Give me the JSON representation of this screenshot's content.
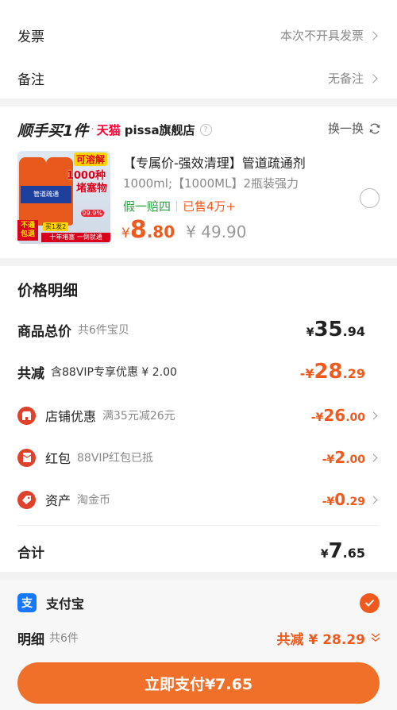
{
  "invoice": {
    "label": "发票",
    "value": "本次不开具发票"
  },
  "note": {
    "label": "备注",
    "value": "无备注"
  },
  "promo": {
    "brand_text": "顺手买1件",
    "dot": "·",
    "tmall": "天猫",
    "shop": "pissa旗舰店",
    "swap": "换一换"
  },
  "product": {
    "title": "【专属价-强效清理】管道疏通剂",
    "spec": "1000ml;【1000ML】2瓶装强力",
    "guarantee": "假一赔四",
    "sold": "已售4万+",
    "price_symbol": "¥",
    "price_int": "8",
    "price_dec": ".80",
    "original_price": "¥ 49.90",
    "thumb": {
      "tag1": "可溶解",
      "tag2": "1000种",
      "tag3": "堵塞物",
      "bottle_label": "管道疏通",
      "percent": "99.9%",
      "badge_left": "不通包退",
      "badge_buy": "买1发2",
      "badge_bottom": "十年堵塞 一倒就通"
    }
  },
  "details": {
    "title": "价格明细",
    "total_goods": {
      "label": "商品总价",
      "sub": "共6件宝贝",
      "sym": "¥",
      "int": "35",
      "dec": ".94"
    },
    "reduce": {
      "label": "共减",
      "sub": "含88VIP专享优惠 ¥ 2.00",
      "prefix": "-¥",
      "int": "28",
      "dec": ".29"
    },
    "items": [
      {
        "label": "店铺优惠",
        "sub": "满35元减26元",
        "prefix": "-¥",
        "int": "26",
        "dec": ".00",
        "icon": "shop-icon"
      },
      {
        "label": "红包",
        "sub": "88VIP红包已抵",
        "prefix": "-¥",
        "int": "2",
        "dec": ".00",
        "icon": "red-packet-icon"
      },
      {
        "label": "资产",
        "sub": "淘金币",
        "prefix": "-¥",
        "int": "0",
        "dec": ".29",
        "icon": "coin-tag-icon"
      }
    ],
    "sum": {
      "label": "合计",
      "sym": "¥",
      "int": "7",
      "dec": ".65"
    }
  },
  "payment": {
    "method": "支付宝",
    "alipay_glyph": "支",
    "detail_label": "明细",
    "detail_sub": "共6件",
    "reduce_text": "共减 ¥ 28.29",
    "pay_button": "立即支付¥7.65"
  },
  "colors": {
    "accent": "#f05a1e",
    "alipay": "#1677ff"
  }
}
